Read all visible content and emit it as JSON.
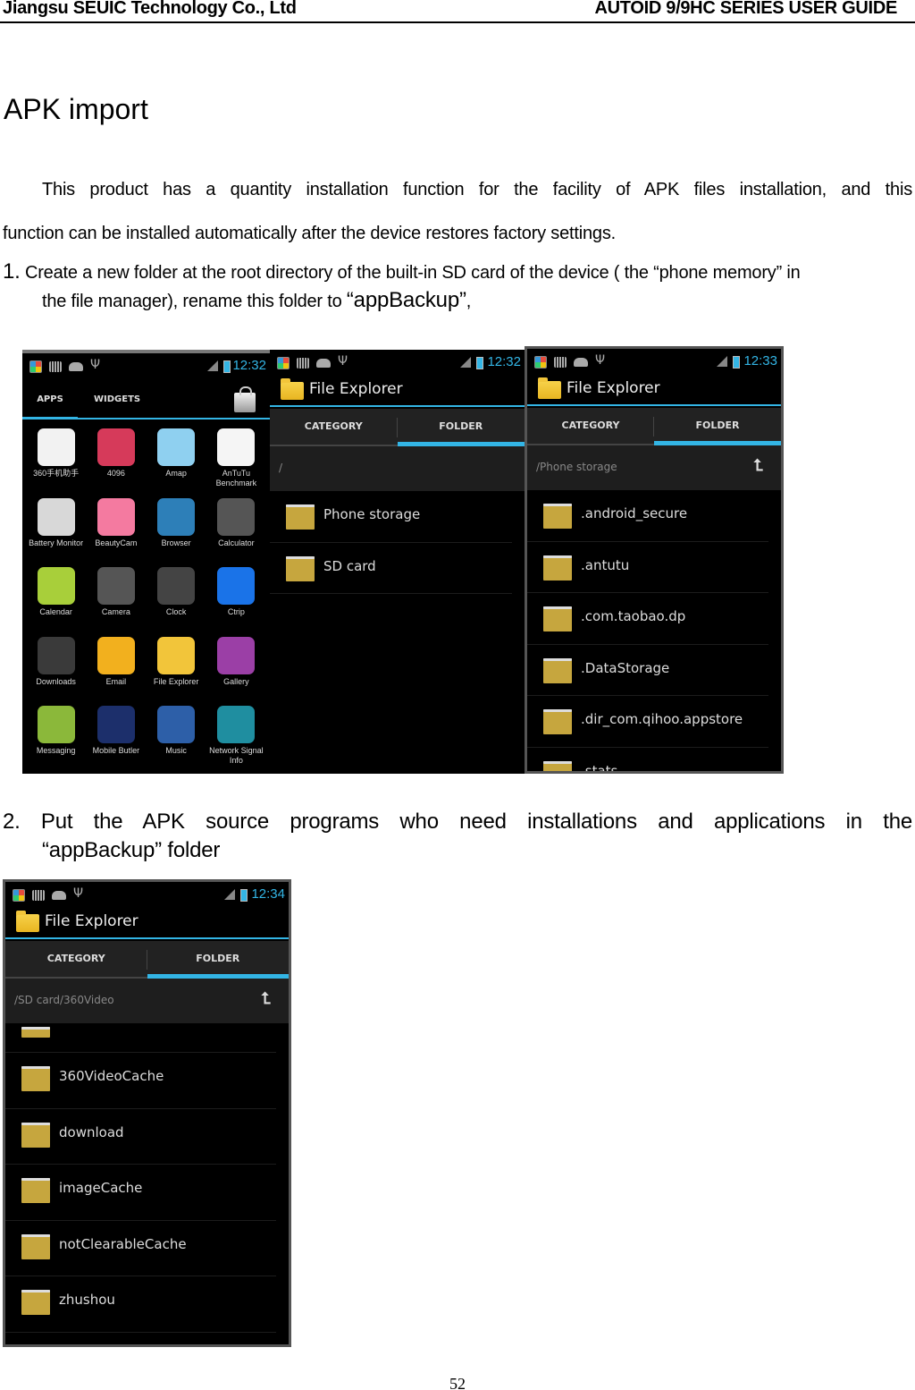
{
  "header": {
    "company": "Jiangsu SEUIC Technology Co., Ltd",
    "guide": "AUTOID 9/9HC SERIES USER GUIDE"
  },
  "section_title": "APK import",
  "intro": {
    "line1": "This product has a quantity installation function for the facility of APK files installation, and this",
    "line2": "function can be installed automatically after the device restores factory settings."
  },
  "step1": {
    "number": "1.",
    "line1": " Create a new folder at the root directory of the built-in SD card of the device ( the “phone memory” in",
    "line2_pre": "the file manager), rename this folder to ",
    "line2_big": "“appBackup”",
    "line2_post": ","
  },
  "step2": {
    "line1": "2. Put the APK source programs who need installations and applications in the",
    "line2": "“appBackup” folder"
  },
  "page_number": "52",
  "colors": {
    "accent": "#33b5e5",
    "folder": "#c6a63e",
    "screen_bg": "#000000"
  },
  "screens": {
    "launcher": {
      "time": "12:32",
      "tabs": [
        "APPS",
        "WIDGETS"
      ],
      "apps": [
        {
          "label": "360手机助手",
          "icon": "360-assistant-icon",
          "color": "#f2f2f2"
        },
        {
          "label": "4096",
          "icon": "4096-game-icon",
          "color": "#d63a5a"
        },
        {
          "label": "Amap",
          "icon": "amap-icon",
          "color": "#8fd0f0"
        },
        {
          "label": "AnTuTu Benchmark",
          "icon": "antutu-icon",
          "color": "#f5f5f5"
        },
        {
          "label": "Battery Monitor",
          "icon": "battery-monitor-icon",
          "color": "#d8d8d8"
        },
        {
          "label": "BeautyCam",
          "icon": "beautycam-icon",
          "color": "#f47aa0"
        },
        {
          "label": "Browser",
          "icon": "browser-globe-icon",
          "color": "#2d7fb8"
        },
        {
          "label": "Calculator",
          "icon": "calculator-icon",
          "color": "#555555"
        },
        {
          "label": "Calendar",
          "icon": "calendar-icon",
          "color": "#a8cf3a"
        },
        {
          "label": "Camera",
          "icon": "camera-icon",
          "color": "#555555"
        },
        {
          "label": "Clock",
          "icon": "clock-icon",
          "color": "#444444"
        },
        {
          "label": "Ctrip",
          "icon": "ctrip-icon",
          "color": "#1a73e8"
        },
        {
          "label": "Downloads",
          "icon": "downloads-icon",
          "color": "#3a3a3a"
        },
        {
          "label": "Email",
          "icon": "email-icon",
          "color": "#f2b01e"
        },
        {
          "label": "File Explorer",
          "icon": "file-explorer-icon",
          "color": "#f2c53a"
        },
        {
          "label": "Gallery",
          "icon": "gallery-icon",
          "color": "#9b3fa6"
        },
        {
          "label": "Messaging",
          "icon": "messaging-icon",
          "color": "#8bb83a"
        },
        {
          "label": "Mobile Butler",
          "icon": "mobile-butler-icon",
          "color": "#1c2f6b"
        },
        {
          "label": "Music",
          "icon": "music-speaker-icon",
          "color": "#2d5fa8"
        },
        {
          "label": "Network Signal Info",
          "icon": "network-signal-icon",
          "color": "#1f8ea0"
        }
      ]
    },
    "explorer_root": {
      "time": "12:32",
      "app_title": "File Explorer",
      "tabs": [
        "CATEGORY",
        "FOLDER"
      ],
      "path": "/",
      "folders": [
        "Phone storage",
        "SD card"
      ]
    },
    "explorer_phone": {
      "time": "12:33",
      "app_title": "File Explorer",
      "tabs": [
        "CATEGORY",
        "FOLDER"
      ],
      "path": "/Phone storage",
      "folders": [
        ".android_secure",
        ".antutu",
        ".com.taobao.dp",
        ".DataStorage",
        ".dir_com.qihoo.appstore",
        ".stats"
      ]
    },
    "explorer_sd": {
      "time": "12:34",
      "app_title": "File Explorer",
      "tabs": [
        "CATEGORY",
        "FOLDER"
      ],
      "path": "/SD card/360Video",
      "folders": [
        "360VideoCache",
        "download",
        "imageCache",
        "notClearableCache",
        "zhushou"
      ]
    }
  }
}
